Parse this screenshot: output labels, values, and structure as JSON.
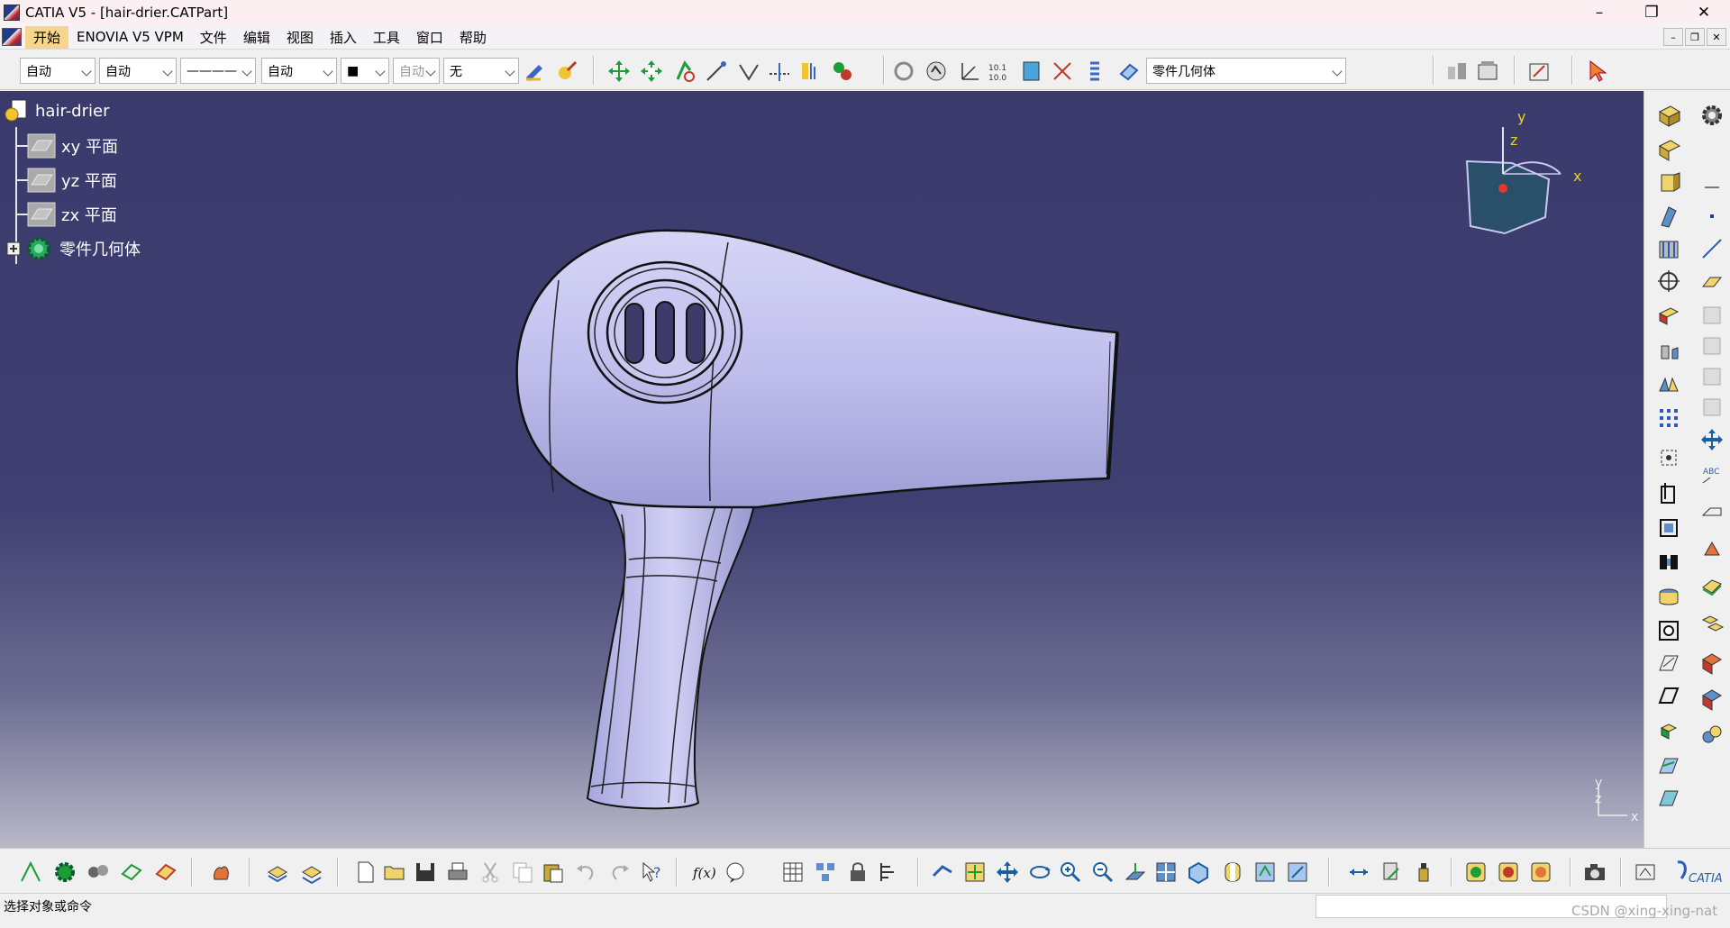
{
  "window": {
    "title": "CATIA V5 - [hair-drier.CATPart]",
    "controls": [
      "–",
      "❐",
      "✕"
    ]
  },
  "menubar": {
    "items": [
      "开始",
      "ENOVIA V5 VPM",
      "文件",
      "编辑",
      "视图",
      "插入",
      "工具",
      "窗口",
      "帮助"
    ],
    "active": "开始"
  },
  "toolbar": {
    "color_combo": "自动",
    "transparency_combo": "自动",
    "linetype_combo": "————",
    "thickness_combo": "自动",
    "point_symbol_combo": "■",
    "layer_label_combo": "自动",
    "layer_combo": "无",
    "work_object_combo": "零件几何体"
  },
  "tree": {
    "root": "hair-drier",
    "children": [
      "xy 平面",
      "yz 平面",
      "zx 平面",
      "零件几何体"
    ]
  },
  "compass": {
    "x": "x",
    "y": "y",
    "z": "z"
  },
  "axis_indicator": {
    "y": "y",
    "z": "z",
    "x": "x"
  },
  "status": {
    "message": "选择对象或命令",
    "watermark": "CSDN @xing-xing-nat"
  },
  "brand": {
    "logo_text": "CATIA"
  },
  "colors": {
    "viewport_top": "#3a3a6c",
    "viewport_bottom": "#b8b8c8",
    "model_fill": "#c7c6f0",
    "menu_active": "#f6d68a"
  }
}
